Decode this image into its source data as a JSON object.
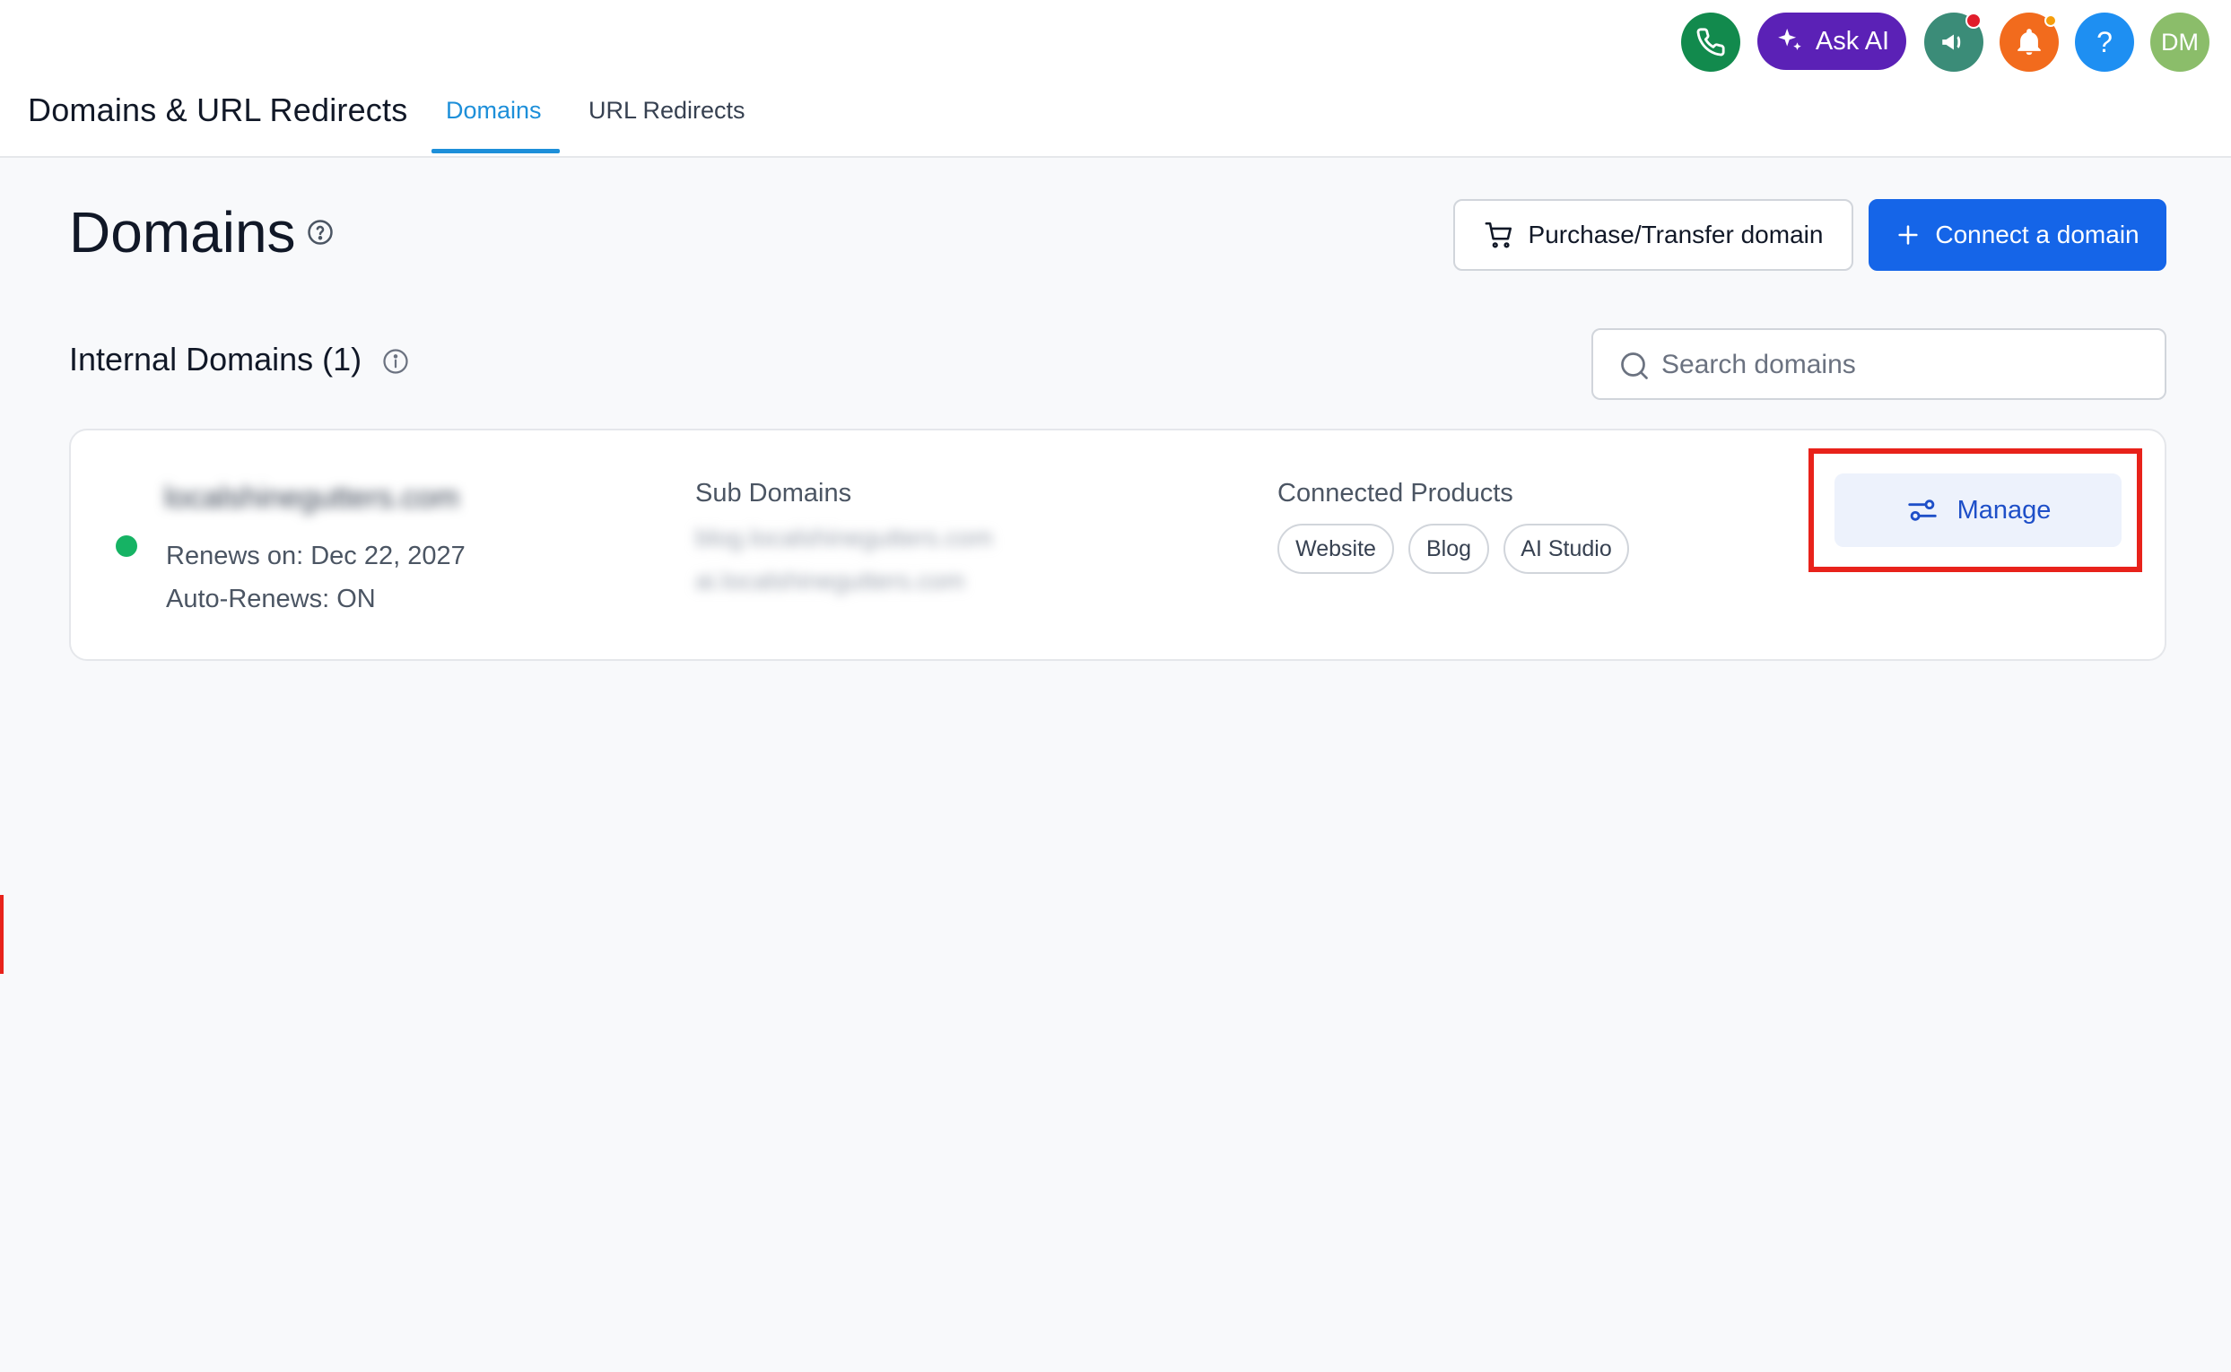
{
  "header": {
    "app_title": "Domains & URL Redirects",
    "tabs": [
      {
        "label": "Domains",
        "active": true
      },
      {
        "label": "URL Redirects",
        "active": false
      }
    ],
    "ask_ai_label": "Ask AI",
    "help_label": "?",
    "avatar_initials": "DM"
  },
  "page": {
    "title": "Domains",
    "purchase_button": "Purchase/Transfer domain",
    "connect_button": "Connect a domain"
  },
  "section": {
    "title": "Internal Domains (1)",
    "search_placeholder": "Search domains"
  },
  "domain_card": {
    "domain_name": "localshinegutters.com",
    "renews_on": "Renews on: Dec 22, 2027",
    "auto_renews": "Auto-Renews: ON",
    "sub_domains_label": "Sub Domains",
    "sub_domains": [
      "blog.localshinegutters.com",
      "ai.localshinegutters.com"
    ],
    "connected_products_label": "Connected Products",
    "products": [
      "Website",
      "Blog",
      "AI Studio"
    ],
    "manage_button": "Manage",
    "status_color": "#16b364"
  },
  "colors": {
    "accent_tab": "#1d8fd9",
    "primary_button": "#1565e8",
    "ask_ai": "#5b21b6",
    "phone": "#128a4d",
    "announce": "#3b8c78",
    "bell": "#f26b1d",
    "help": "#1e8ff2",
    "avatar": "#8bbd6a",
    "highlight": "#e8221b"
  }
}
